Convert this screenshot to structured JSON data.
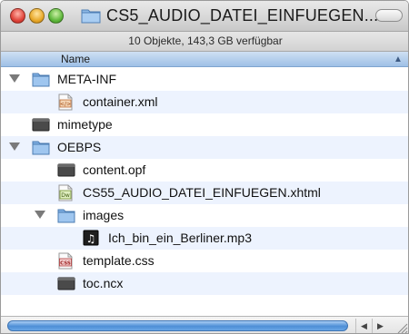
{
  "window": {
    "title": "CS5_AUDIO_DATEI_EINFUEGEN...",
    "status": "10 Objekte, 143,3 GB verfügbar"
  },
  "columns": {
    "name_label": "Name",
    "sort_indicator": "▲"
  },
  "files": [
    {
      "name": "META-INF",
      "kind": "folder",
      "expanded": true,
      "level": 0
    },
    {
      "name": "container.xml",
      "kind": "xml-file",
      "level": 1
    },
    {
      "name": "mimetype",
      "kind": "generic-file",
      "level": 0
    },
    {
      "name": "OEBPS",
      "kind": "folder",
      "expanded": true,
      "level": 0
    },
    {
      "name": "content.opf",
      "kind": "generic-file",
      "level": 1
    },
    {
      "name": "CS55_AUDIO_DATEI_EINFUEGEN.xhtml",
      "kind": "dreamweaver-file",
      "level": 1
    },
    {
      "name": "images",
      "kind": "folder",
      "expanded": true,
      "level": 1
    },
    {
      "name": "Ich_bin_ein_Berliner.mp3",
      "kind": "audio-file",
      "level": 2
    },
    {
      "name": "template.css",
      "kind": "css-file",
      "level": 1
    },
    {
      "name": "toc.ncx",
      "kind": "generic-file",
      "level": 1
    }
  ],
  "icons": {
    "xml_badge": "</>",
    "dreamweaver_badge": "Dw",
    "css_badge": "CSS",
    "audio_glyph": "♫"
  },
  "scroll": {
    "left_arrow": "◀",
    "right_arrow": "▶"
  }
}
